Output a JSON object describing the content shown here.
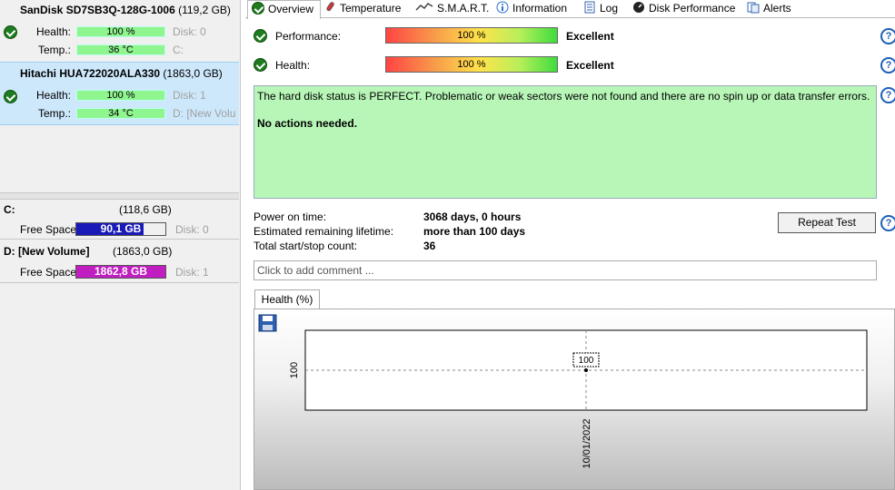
{
  "disks": [
    {
      "name": "SanDisk SD7SB3Q-128G-1006",
      "size": "(119,2 GB)",
      "health_label": "Health:",
      "health_value": "100 %",
      "disk_id": "Disk: 0",
      "temp_label": "Temp.:",
      "temp_value": "36 °C",
      "drive": "C:"
    },
    {
      "name": "Hitachi HUA722020ALA330",
      "size": "(1863,0 GB)",
      "health_label": "Health:",
      "health_value": "100 %",
      "disk_id": "Disk: 1",
      "temp_label": "Temp.:",
      "temp_value": "34 °C",
      "drive": "D: [New Volu"
    }
  ],
  "volumes": [
    {
      "name": "C:",
      "size": "(118,6 GB)",
      "free_label": "Free Space",
      "free_value": "90,1 GB",
      "disk_id": "Disk: 0",
      "bar_color": "#1a1ab8",
      "fill": 0.76
    },
    {
      "name": "D: [New Volume]",
      "size": "(1863,0 GB)",
      "free_label": "Free Space",
      "free_value": "1862,8 GB",
      "disk_id": "Disk: 1",
      "bar_color": "#c01ec0",
      "fill": 1.0
    }
  ],
  "tabs": [
    "Overview",
    "Temperature",
    "S.M.A.R.T.",
    "Information",
    "Log",
    "Disk Performance",
    "Alerts"
  ],
  "overview": {
    "performance_label": "Performance:",
    "performance_value": "100 %",
    "performance_text": "Excellent",
    "health_label": "Health:",
    "health_value": "100 %",
    "health_text": "Excellent",
    "status_line1": "The hard disk status is PERFECT. Problematic or weak sectors were not found and there are no spin up or data transfer errors.",
    "status_line2": "No actions needed.",
    "power_on_label": "Power on time:",
    "power_on_value": "3068 days, 0 hours",
    "lifetime_label": "Estimated remaining lifetime:",
    "lifetime_value": "more than 100 days",
    "startstop_label": "Total start/stop count:",
    "startstop_value": "36",
    "repeat_button": "Repeat Test",
    "comment_placeholder": "Click to add comment ...",
    "help_glyph": "?"
  },
  "chart_data": {
    "type": "line",
    "tab_label": "Health (%)",
    "x": [
      "10/01/2022"
    ],
    "series": [
      {
        "values": [
          100
        ]
      }
    ],
    "y_tick": "100",
    "data_label": "100"
  }
}
